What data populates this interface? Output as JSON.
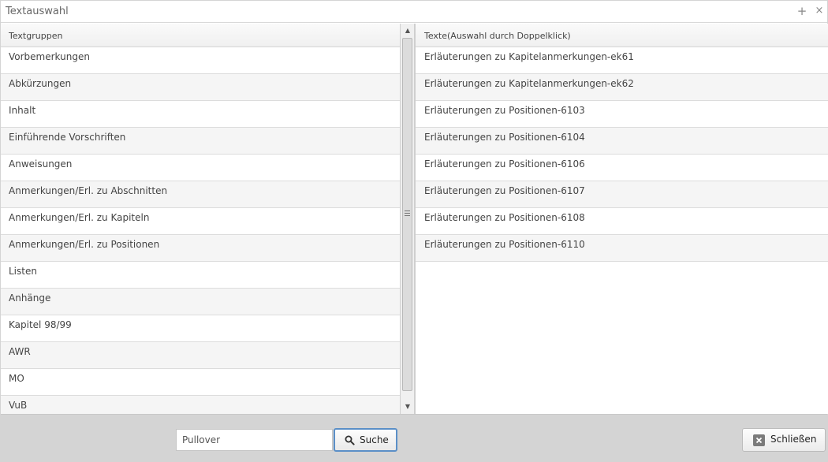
{
  "window": {
    "title": "Textauswahl",
    "add_symbol": "+",
    "close_symbol": "×"
  },
  "left_panel": {
    "header": "Textgruppen",
    "items": [
      {
        "label": "Vorbemerkungen"
      },
      {
        "label": "Abkürzungen"
      },
      {
        "label": "Inhalt"
      },
      {
        "label": "Einführende Vorschriften"
      },
      {
        "label": "Anweisungen"
      },
      {
        "label": "Anmerkungen/Erl. zu Abschnitten"
      },
      {
        "label": "Anmerkungen/Erl. zu Kapiteln"
      },
      {
        "label": "Anmerkungen/Erl. zu Positionen"
      },
      {
        "label": "Listen"
      },
      {
        "label": "Anhänge"
      },
      {
        "label": "Kapitel 98/99"
      },
      {
        "label": "AWR"
      },
      {
        "label": "MO"
      },
      {
        "label": "VuB"
      }
    ]
  },
  "right_panel": {
    "header": "Texte(Auswahl durch Doppelklick)",
    "items": [
      {
        "label": "Erläuterungen zu Kapitelanmerkungen-ek61"
      },
      {
        "label": "Erläuterungen zu Kapitelanmerkungen-ek62"
      },
      {
        "label": "Erläuterungen zu Positionen-6103"
      },
      {
        "label": "Erläuterungen zu Positionen-6104"
      },
      {
        "label": "Erläuterungen zu Positionen-6106"
      },
      {
        "label": "Erläuterungen zu Positionen-6107"
      },
      {
        "label": "Erläuterungen zu Positionen-6108"
      },
      {
        "label": "Erläuterungen zu Positionen-6110"
      }
    ]
  },
  "footer": {
    "search_value": "Pullover",
    "search_label": "Suche",
    "close_label": "Schließen"
  },
  "icons": {
    "search": "magnifier-icon",
    "close": "close-x-icon"
  },
  "colors": {
    "footer_bg": "#d4d4d4",
    "focus_border": "#5b8fc7",
    "alt_row": "#f5f5f5"
  }
}
